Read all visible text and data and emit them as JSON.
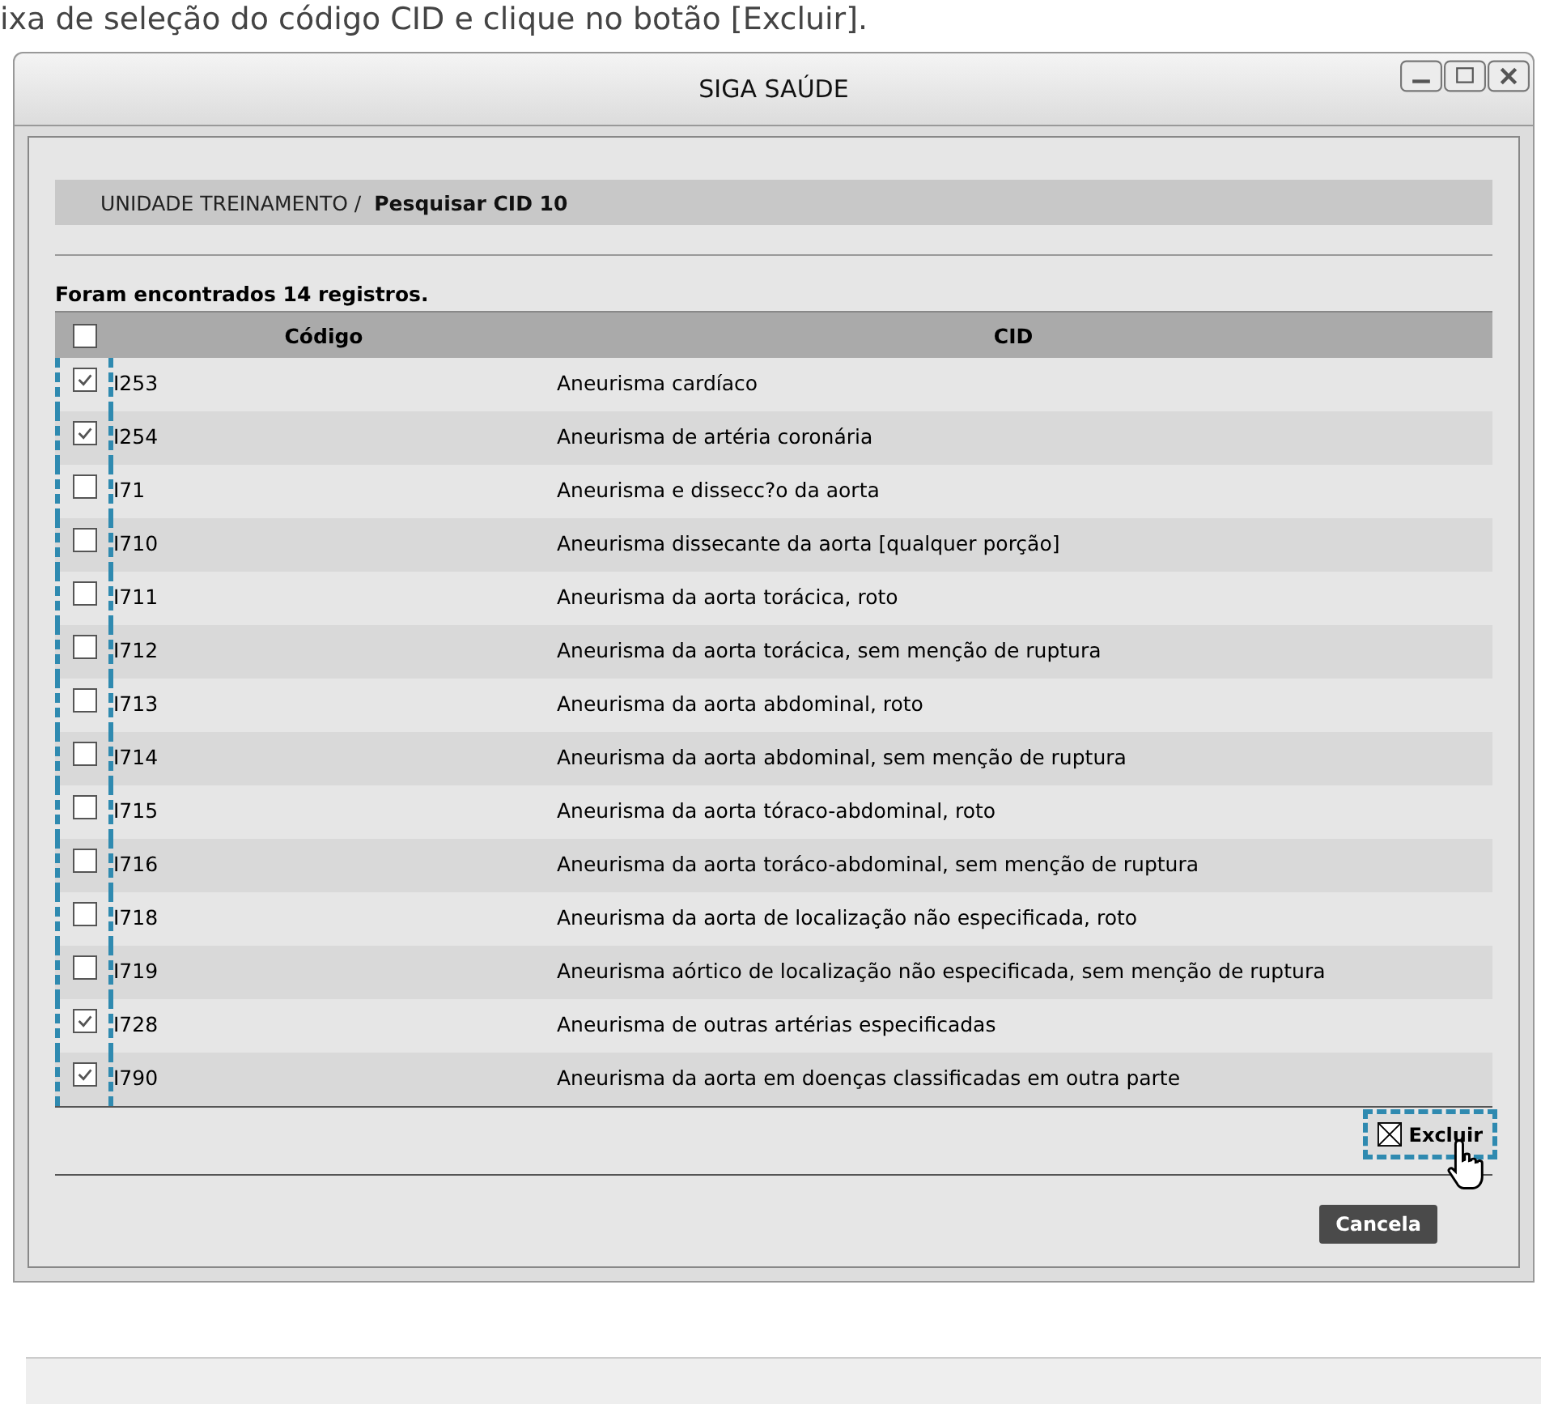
{
  "caption": "ixa de seleção do código CID e clique no botão [Excluir].",
  "window": {
    "title": "SIGA SAÚDE"
  },
  "breadcrumb": {
    "parent": "UNIDADE TREINAMENTO /",
    "current": "Pesquisar CID 10"
  },
  "result_count": "Foram encontrados 14 registros.",
  "table": {
    "select_all": {
      "checked": false
    },
    "columns": [
      "Código",
      "CID"
    ],
    "rows": [
      {
        "code": "I253",
        "description": "Aneurisma cardíaco",
        "checked": true
      },
      {
        "code": "I254",
        "description": "Aneurisma de artéria coronária",
        "checked": true
      },
      {
        "code": "I71",
        "description": "Aneurisma e dissecc?o da aorta",
        "checked": false
      },
      {
        "code": "I710",
        "description": "Aneurisma dissecante da aorta [qualquer porção]",
        "checked": false
      },
      {
        "code": "I711",
        "description": "Aneurisma da aorta torácica, roto",
        "checked": false
      },
      {
        "code": "I712",
        "description": "Aneurisma da aorta torácica, sem menção de ruptura",
        "checked": false
      },
      {
        "code": "I713",
        "description": "Aneurisma da aorta abdominal, roto",
        "checked": false
      },
      {
        "code": "I714",
        "description": "Aneurisma da aorta abdominal, sem menção de ruptura",
        "checked": false
      },
      {
        "code": "I715",
        "description": "Aneurisma da aorta tóraco-abdominal, roto",
        "checked": false
      },
      {
        "code": "I716",
        "description": "Aneurisma da aorta toráco-abdominal, sem menção de ruptura",
        "checked": false
      },
      {
        "code": "I718",
        "description": "Aneurisma da aorta de localização não especificada, roto",
        "checked": false
      },
      {
        "code": "I719",
        "description": "Aneurisma aórtico de localização não especificada, sem menção de ruptura",
        "checked": false
      },
      {
        "code": "I728",
        "description": "Aneurisma de outras artérias especificadas",
        "checked": true
      },
      {
        "code": "I790",
        "description": "Aneurisma da aorta em doenças classificadas em outra parte",
        "checked": true
      }
    ]
  },
  "buttons": {
    "delete": "Excluir",
    "cancel": "Cancela"
  }
}
